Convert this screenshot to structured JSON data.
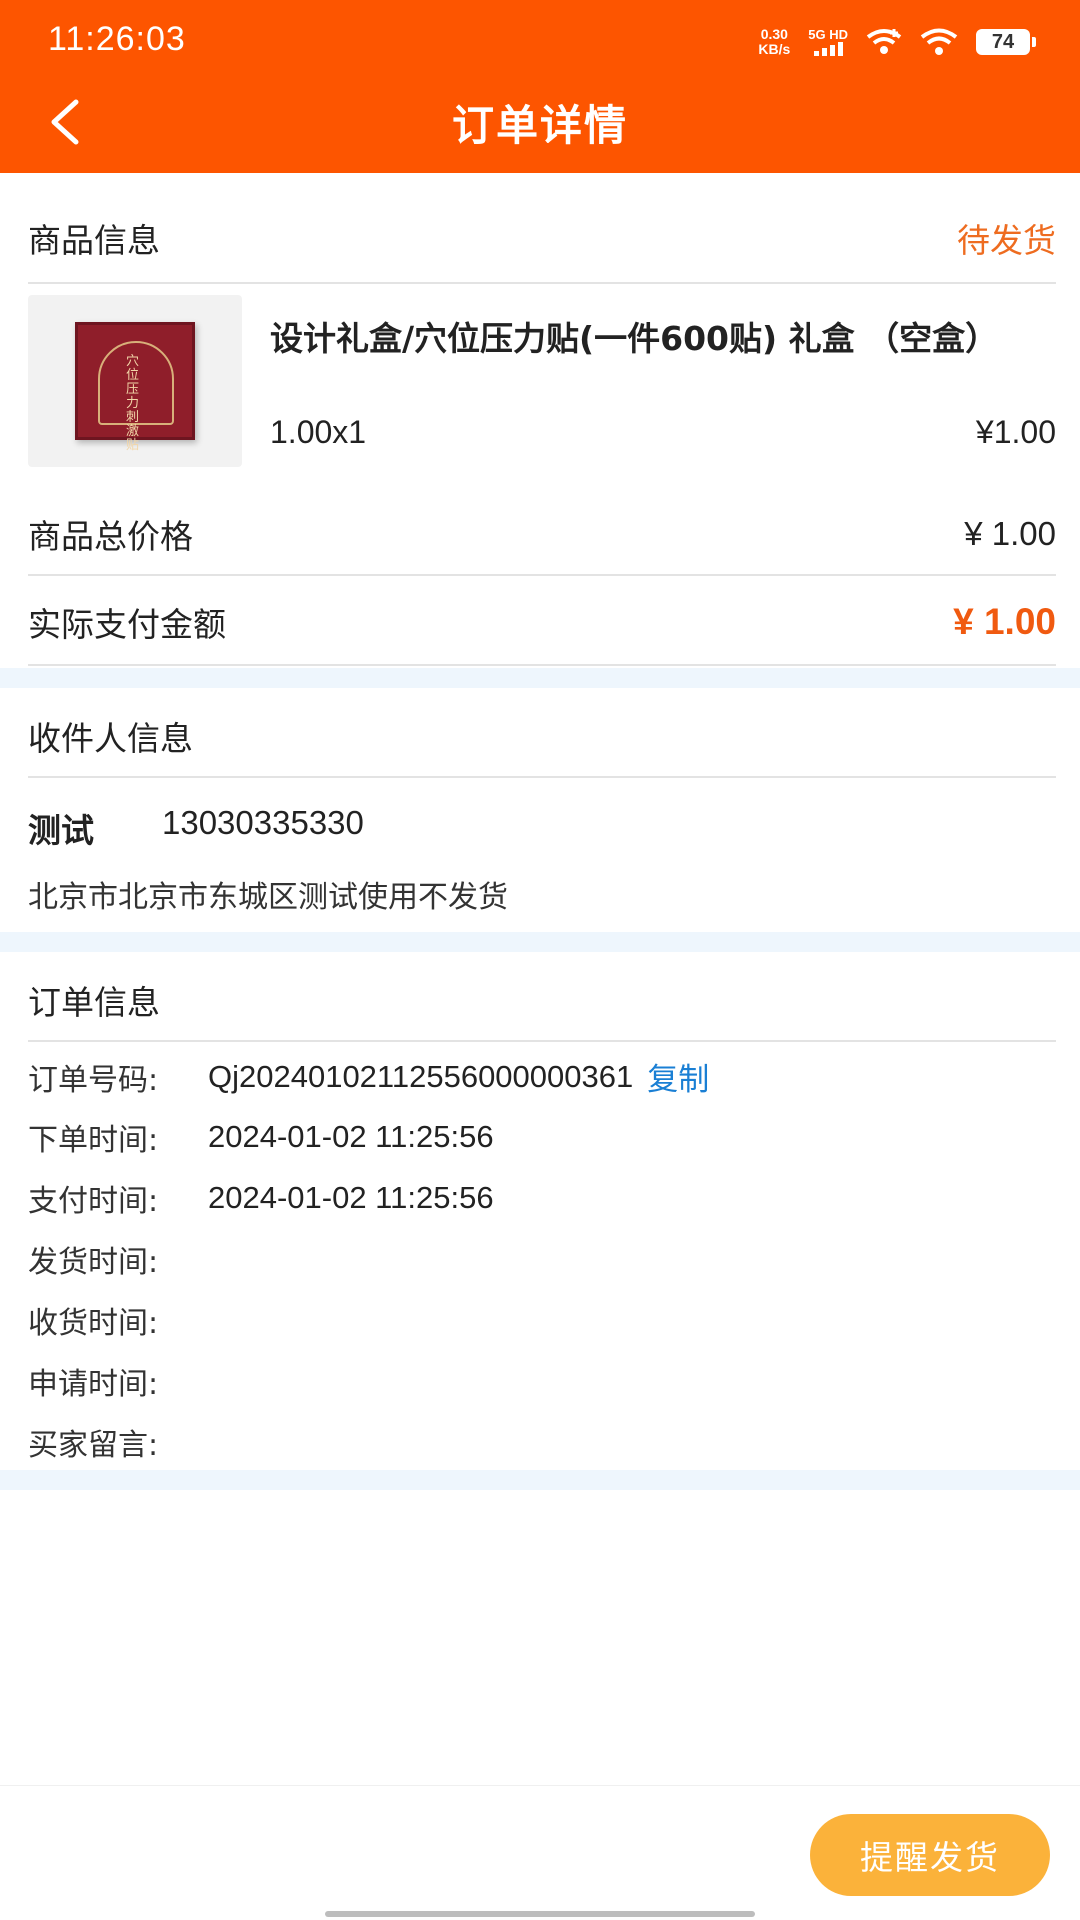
{
  "status_bar": {
    "time": "11:26:03",
    "net_speed_value": "0.30",
    "net_speed_unit": "KB/s",
    "network": "5G HD",
    "battery": "74"
  },
  "header": {
    "title": "订单详情"
  },
  "product_section": {
    "heading": "商品信息",
    "order_status": "待发货",
    "product": {
      "name": "设计礼盒/穴位压力贴(一件600贴) 礼盒 （空盒）",
      "quantity": "1.00x1",
      "price": "¥1.00",
      "box_text": "穴位压力刺激贴"
    },
    "total_label": "商品总价格",
    "total_value": "¥ 1.00",
    "paid_label": "实际支付金额",
    "paid_value": "¥ 1.00"
  },
  "recipient_section": {
    "heading": "收件人信息",
    "name": "测试",
    "phone": "13030335330",
    "address": "北京市北京市东城区测试使用不发货"
  },
  "order_section": {
    "heading": "订单信息",
    "order_no_label": "订单号码:",
    "order_no": "Qj20240102112556000000361",
    "copy_label": "复制",
    "order_time_label": "下单时间:",
    "order_time": "2024-01-02 11:25:56",
    "pay_time_label": "支付时间:",
    "pay_time": "2024-01-02 11:25:56",
    "ship_time_label": "发货时间:",
    "receive_time_label": "收货时间:",
    "apply_time_label": "申请时间:",
    "buyer_msg_label": "买家留言:"
  },
  "bottom": {
    "remind_button": "提醒发货"
  },
  "colors": {
    "header_bg": "#fd5500",
    "status_orange": "#ee6c20",
    "pay_orange": "#f05a10",
    "link_blue": "#1a7fd4",
    "button_yellow": "#fbb23a"
  }
}
